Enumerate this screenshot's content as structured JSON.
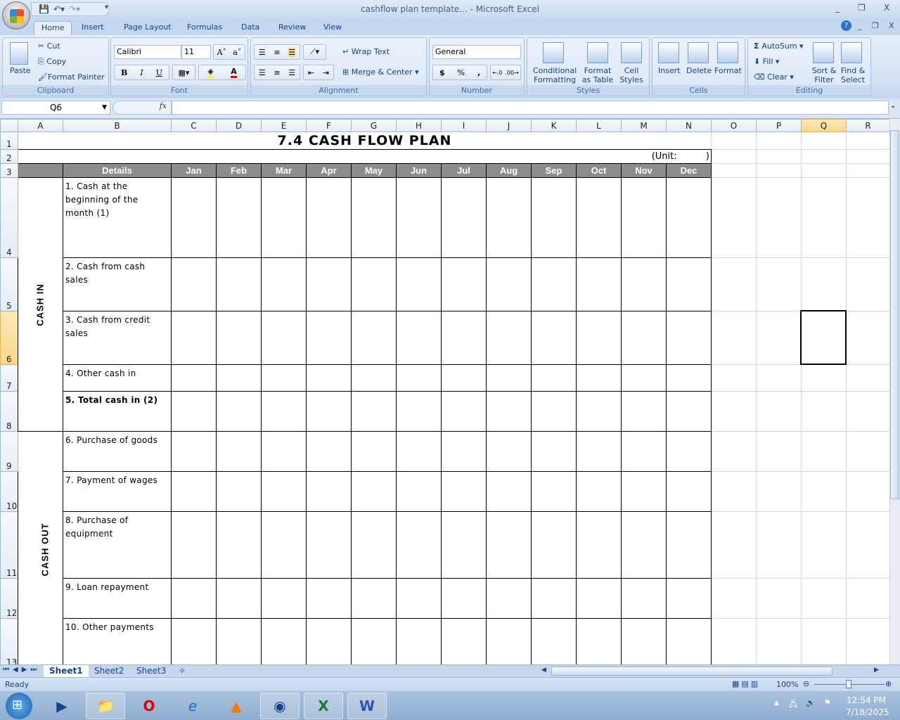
{
  "window": {
    "title": "cashflow plan template... - Microsoft Excel",
    "minimize": "_",
    "restore": "❐",
    "close": "X"
  },
  "tabs": [
    "Home",
    "Insert",
    "Page Layout",
    "Formulas",
    "Data",
    "Review",
    "View"
  ],
  "ribbon": {
    "clipboard": {
      "paste": "Paste",
      "cut": "Cut",
      "copy": "Copy",
      "format_painter": "Format Painter",
      "label": "Clipboard"
    },
    "font": {
      "name": "Calibri",
      "size": "11",
      "bold": "B",
      "italic": "I",
      "underline": "U",
      "label": "Font"
    },
    "alignment": {
      "wrap": "Wrap Text",
      "merge": "Merge & Center",
      "label": "Alignment"
    },
    "number": {
      "format": "General",
      "currency": "$",
      "percent": "%",
      "comma": ",",
      "label": "Number"
    },
    "styles": {
      "conditional": "Conditional Formatting",
      "format_table": "Format as Table",
      "cell_styles": "Cell Styles",
      "label": "Styles"
    },
    "cells": {
      "insert": "Insert",
      "delete": "Delete",
      "format": "Format",
      "label": "Cells"
    },
    "editing": {
      "autosum": "AutoSum",
      "fill": "Fill",
      "clear": "Clear",
      "sort": "Sort & Filter",
      "find": "Find & Select",
      "label": "Editing"
    }
  },
  "formula_bar": {
    "name_box": "Q6",
    "fx": "fx",
    "value": ""
  },
  "columns": [
    "A",
    "B",
    "C",
    "D",
    "E",
    "F",
    "G",
    "H",
    "I",
    "J",
    "K",
    "L",
    "M",
    "N",
    "O",
    "P",
    "Q",
    "R"
  ],
  "rows": [
    "1",
    "2",
    "3",
    "4",
    "5",
    "6",
    "7",
    "8",
    "9",
    "10",
    "11",
    "12",
    "13"
  ],
  "selected": {
    "col": "Q",
    "row": "6"
  },
  "sheet": {
    "title": "7.4 CASH FLOW PLAN",
    "unit": "(Unit:          )",
    "header": [
      "Details",
      "Jan",
      "Feb",
      "Mar",
      "Apr",
      "May",
      "Jun",
      "Jul",
      "Aug",
      "Sep",
      "Oct",
      "Nov",
      "Dec"
    ],
    "cash_in_label": "CASH IN",
    "cash_out_label": "CASH OUT",
    "items": [
      "1. Cash at the beginning of the month (1)",
      "2. Cash from cash sales",
      "3. Cash from credit sales",
      "4. Other cash in",
      "5. Total cash in (2)",
      "6. Purchase of goods",
      "7. Payment of wages",
      "8. Purchase of equipment",
      "9. Loan repayment",
      "10. Other payments"
    ]
  },
  "sheet_tabs": [
    "Sheet1",
    "Sheet2",
    "Sheet3"
  ],
  "status": {
    "text": "Ready",
    "zoom": "100%"
  },
  "taskbar": {
    "time": "12:54 PM",
    "date": "7/18/2025"
  }
}
